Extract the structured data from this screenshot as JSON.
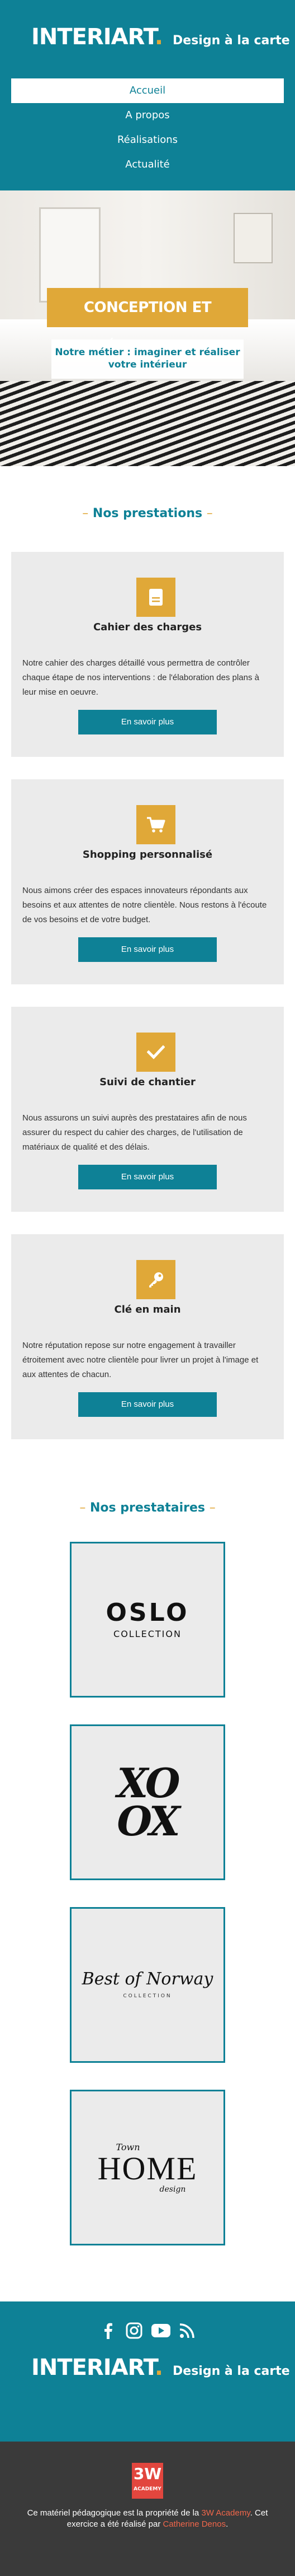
{
  "header": {
    "logo": {
      "part1": "INTERI",
      "part2": "ART",
      "dot": "."
    },
    "tagline": "Design à la carte",
    "nav": [
      "Accueil",
      "A propos",
      "Réalisations",
      "Actualité"
    ]
  },
  "hero": {
    "title": "CONCEPTION ET RÉALISATION",
    "subtitle_line1": "Notre métier : imaginer et réaliser",
    "subtitle_line2": "votre intérieur"
  },
  "services": {
    "title": "Nos prestations",
    "dash": "–",
    "items": [
      {
        "icon": "document-icon",
        "title": "Cahier des charges",
        "text": "Notre cahier des charges détaillé vous permettra de contrôler chaque étape de nos interventions : de l'élaboration des plans à leur mise en oeuvre.",
        "button": "En savoir plus"
      },
      {
        "icon": "cart-icon",
        "title": "Shopping personnalisé",
        "text": "Nous aimons créer des espaces innovateurs répondants aux besoins et aux attentes de notre clientèle. Nous restons à l'écoute de vos besoins et de votre budget.",
        "button": "En savoir plus"
      },
      {
        "icon": "check-icon",
        "title": "Suivi de chantier",
        "text": "Nous assurons un suivi auprès des prestataires afin de nous assurer du respect du cahier des charges, de l'utilisation de matériaux de qualité et des délais.",
        "button": "En savoir plus"
      },
      {
        "icon": "key-icon",
        "title": "Clé en main",
        "text": "Notre réputation repose sur notre engagement à travailler étroitement avec notre clientèle pour livrer un projet à l'image et aux attentes de chacun.",
        "button": "En savoir plus"
      }
    ]
  },
  "partners": {
    "title": "Nos prestataires",
    "dash": "–",
    "logos": [
      {
        "line1": "OSLO",
        "line2": "COLLECTION"
      },
      {
        "line1": "XO",
        "line2": "OX"
      },
      {
        "line1": "Best of Norway",
        "line2": "COLLECTION"
      },
      {
        "line1": "Town",
        "line2": "HOME",
        "line3": "design"
      }
    ]
  },
  "footer": {
    "social": [
      "facebook-icon",
      "instagram-icon",
      "youtube-icon",
      "rss-icon"
    ],
    "logo": {
      "part1": "INTERI",
      "part2": "ART",
      "dot": "."
    },
    "tagline": "Design à la carte",
    "badge": {
      "big": "3W",
      "small": "ACADEMY"
    },
    "credit_prefix": "Ce matériel pédagogique est la propriété de la ",
    "credit_link1": "3W Academy",
    "credit_middle": ". Cet exercice a été réalisé par ",
    "credit_link2": "Catherine Denos",
    "credit_suffix": "."
  },
  "colors": {
    "teal": "#0e8196",
    "gold": "#e0a838",
    "card_bg": "#ebebeb",
    "footer_dark": "#3a3a3a",
    "link": "#f0664a"
  }
}
